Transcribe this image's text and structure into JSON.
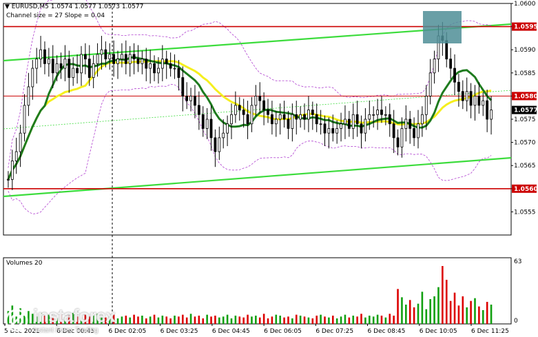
{
  "header": {
    "arrow": "▼",
    "symbol_info": "EURUSD,M5  1.0574 1.0577 1.0573 1.0577",
    "channel_info": "Channel size = 27 Slope = 0.04"
  },
  "volumes_label": "Volumes 20",
  "watermark": {
    "brand": "instaforex",
    "tagline": "Instant Forex Trading"
  },
  "colors": {
    "candle": "#000000",
    "ma_green": "#1e7b1e",
    "ma_yellow": "#f5ef1e",
    "channel": "#3cdc3c",
    "bands": "#b040d0",
    "level_line": "#cc0000",
    "volume_up": "#10a010",
    "volume_down": "#dd0000",
    "highlight_box": "#4f8e96",
    "price_tag_bg": "#cc0000",
    "current_tag_bg": "#000000"
  },
  "chart_data": {
    "type": "candlestick",
    "price_axis": {
      "min": 1.055,
      "max": 1.06,
      "ticks": [
        "1.0600",
        "1.0595",
        "1.0590",
        "1.0585",
        "1.0580",
        "1.0575",
        "1.0570",
        "1.0565",
        "1.0560",
        "1.0555"
      ]
    },
    "time_axis_labels": [
      "5 Dec 2021",
      "6 Dec 00:45",
      "6 Dec 02:05",
      "6 Dec 03:25",
      "6 Dec 04:45",
      "6 Dec 06:05",
      "6 Dec 07:25",
      "6 Dec 08:45",
      "6 Dec 10:05",
      "6 Dec 11:25"
    ],
    "levels": [
      {
        "price": 1.0595,
        "label": "1.0595"
      },
      {
        "price": 1.058,
        "label": "1.0580"
      },
      {
        "price": 1.056,
        "label": "1.0560"
      }
    ],
    "current_price": {
      "price": 1.0577,
      "label": "1.0577"
    },
    "volume_axis": {
      "max": 63,
      "ticks": [
        "63",
        "0"
      ]
    },
    "closes": [
      1.0562,
      1.0566,
      1.0568,
      1.0572,
      1.0578,
      1.0582,
      1.0586,
      1.0588,
      1.059,
      1.0587,
      1.0588,
      1.0585,
      1.0587,
      1.0586,
      1.0588,
      1.0584,
      1.0586,
      1.0585,
      1.0589,
      1.0588,
      1.0584,
      1.0587,
      1.0589,
      1.059,
      1.0588,
      1.0589,
      1.0587,
      1.0588,
      1.0589,
      1.0587,
      1.0589,
      1.0588,
      1.0587,
      1.0588,
      1.0586,
      1.0587,
      1.0585,
      1.0586,
      1.0588,
      1.0587,
      1.0586,
      1.0586,
      1.0584,
      1.058,
      1.0579,
      1.058,
      1.0578,
      1.0576,
      1.0573,
      1.0575,
      1.0571,
      1.0568,
      1.0571,
      1.0572,
      1.0574,
      1.0576,
      1.0578,
      1.0577,
      1.0576,
      1.0574,
      1.0578,
      1.058,
      1.0579,
      1.0577,
      1.0576,
      1.0574,
      1.0575,
      1.0576,
      1.0575,
      1.0573,
      1.0576,
      1.0575,
      1.0576,
      1.0575,
      1.0577,
      1.0576,
      1.0574,
      1.0574,
      1.0572,
      1.0573,
      1.0572,
      1.0573,
      1.0574,
      1.0575,
      1.0573,
      1.0576,
      1.0574,
      1.0572,
      1.0575,
      1.0576,
      1.0576,
      1.0577,
      1.0576,
      1.0576,
      1.0574,
      1.0571,
      1.0569,
      1.0573,
      1.0575,
      1.0573,
      1.0571,
      1.0574,
      1.0576,
      1.058,
      1.0585,
      1.0588,
      1.0593,
      1.0592,
      1.0588,
      1.0586,
      1.0583,
      1.0581,
      1.0579,
      1.0581,
      1.0578,
      1.058,
      1.0578,
      1.0579,
      1.0575,
      1.0577
    ],
    "volumes": [
      14,
      20,
      8,
      17,
      9,
      14,
      11,
      8,
      12,
      9,
      10,
      8,
      6,
      11,
      7,
      9,
      12,
      8,
      7,
      10,
      8,
      9,
      11,
      8,
      7,
      9,
      10,
      6,
      8,
      9,
      7,
      10,
      8,
      9,
      6,
      8,
      10,
      7,
      9,
      8,
      6,
      9,
      8,
      10,
      7,
      11,
      8,
      9,
      6,
      10,
      8,
      9,
      7,
      8,
      10,
      6,
      9,
      8,
      7,
      10,
      8,
      9,
      7,
      11,
      6,
      8,
      10,
      9,
      7,
      8,
      6,
      10,
      9,
      8,
      7,
      6,
      9,
      10,
      8,
      7,
      9,
      6,
      8,
      10,
      7,
      9,
      8,
      11,
      7,
      9,
      8,
      10,
      9,
      7,
      11,
      9,
      38,
      29,
      21,
      26,
      18,
      22,
      35,
      16,
      27,
      30,
      40,
      63,
      48,
      25,
      34,
      20,
      30,
      18,
      25,
      28,
      19,
      15,
      24,
      21
    ]
  }
}
